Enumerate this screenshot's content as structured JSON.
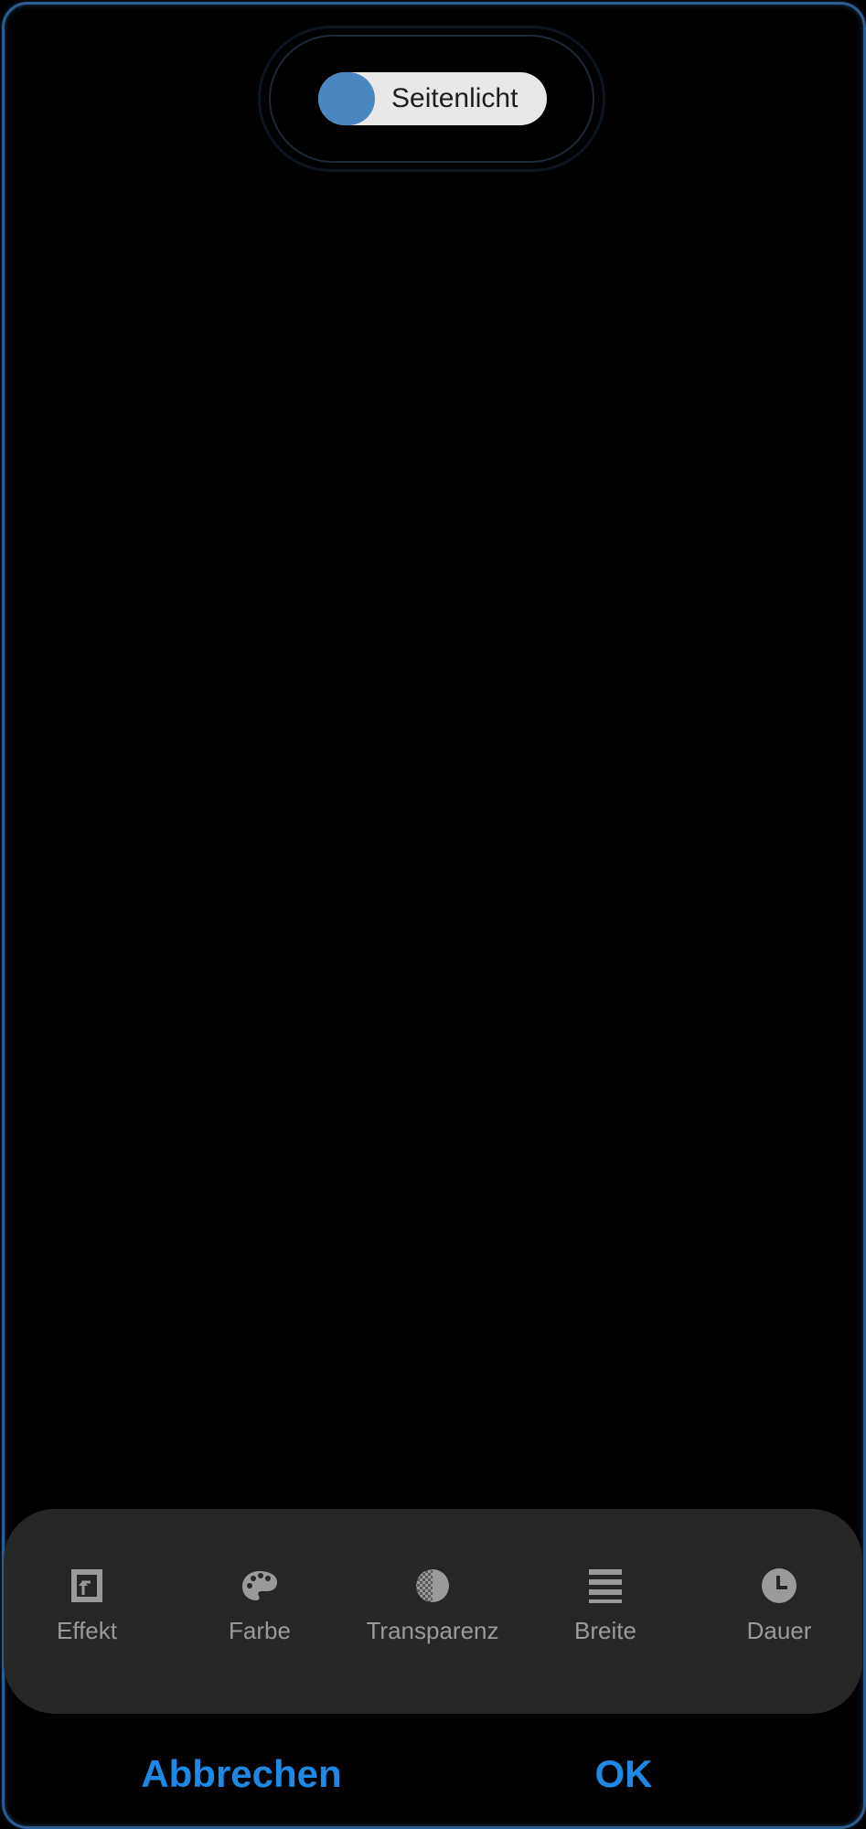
{
  "top_toggle": {
    "label": "Seitenlicht",
    "state": "on",
    "accent_color": "#4a86c0"
  },
  "toolbar": {
    "items": [
      {
        "label": "Effekt",
        "icon": "effect-icon"
      },
      {
        "label": "Farbe",
        "icon": "palette-icon"
      },
      {
        "label": "Transparenz",
        "icon": "transparency-icon"
      },
      {
        "label": "Breite",
        "icon": "width-icon"
      },
      {
        "label": "Dauer",
        "icon": "clock-icon"
      }
    ]
  },
  "actions": {
    "cancel_label": "Abbrechen",
    "ok_label": "OK",
    "color": "#1e88e5"
  },
  "edge_color": "#2b5d8f"
}
